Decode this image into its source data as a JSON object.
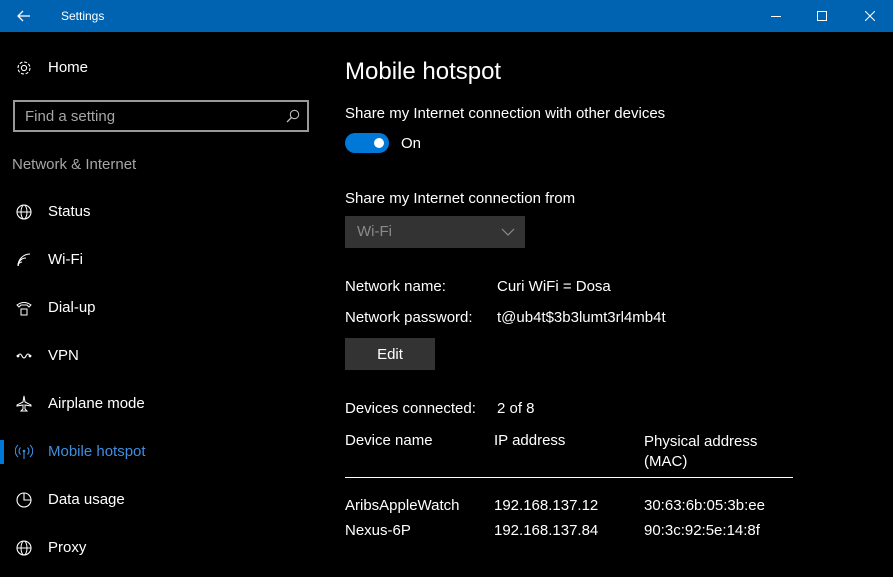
{
  "window": {
    "title": "Settings",
    "minimize_label": "",
    "maximize_label": "",
    "close_label": ""
  },
  "sidebar": {
    "home_label": "Home",
    "search_placeholder": "Find a setting",
    "section_title": "Network & Internet",
    "items": [
      {
        "label": "Status",
        "icon": "globe-icon"
      },
      {
        "label": "Wi-Fi",
        "icon": "wifi-icon"
      },
      {
        "label": "Dial-up",
        "icon": "phone-icon"
      },
      {
        "label": "VPN",
        "icon": "vpn-icon"
      },
      {
        "label": "Airplane mode",
        "icon": "airplane-icon"
      },
      {
        "label": "Mobile hotspot",
        "icon": "hotspot-icon",
        "active": true
      },
      {
        "label": "Data usage",
        "icon": "pie-icon"
      },
      {
        "label": "Proxy",
        "icon": "globe-icon"
      }
    ]
  },
  "main": {
    "title": "Mobile hotspot",
    "share_label": "Share my Internet connection with other devices",
    "toggle_state": "On",
    "share_from_label": "Share my Internet connection from",
    "share_from_value": "Wi-Fi",
    "network_name_label": "Network name:",
    "network_name_value": "Curi WiFi = Dosa",
    "network_password_label": "Network password:",
    "network_password_value": "t@ub4t$3b3lumt3rl4mb4t",
    "edit_label": "Edit",
    "devices_connected_label": "Devices connected:",
    "devices_connected_value": "2 of 8",
    "table": {
      "columns": [
        "Device name",
        "IP address",
        "Physical address (MAC)"
      ],
      "rows": [
        [
          "AribsAppleWatch",
          "192.168.137.12",
          "30:63:6b:05:3b:ee"
        ],
        [
          "Nexus-6P",
          "192.168.137.84",
          "90:3c:92:5e:14:8f"
        ]
      ]
    }
  },
  "colors": {
    "titlebar": "#0063b1",
    "accent": "#0078d7",
    "active_text": "#3f8fe0"
  }
}
